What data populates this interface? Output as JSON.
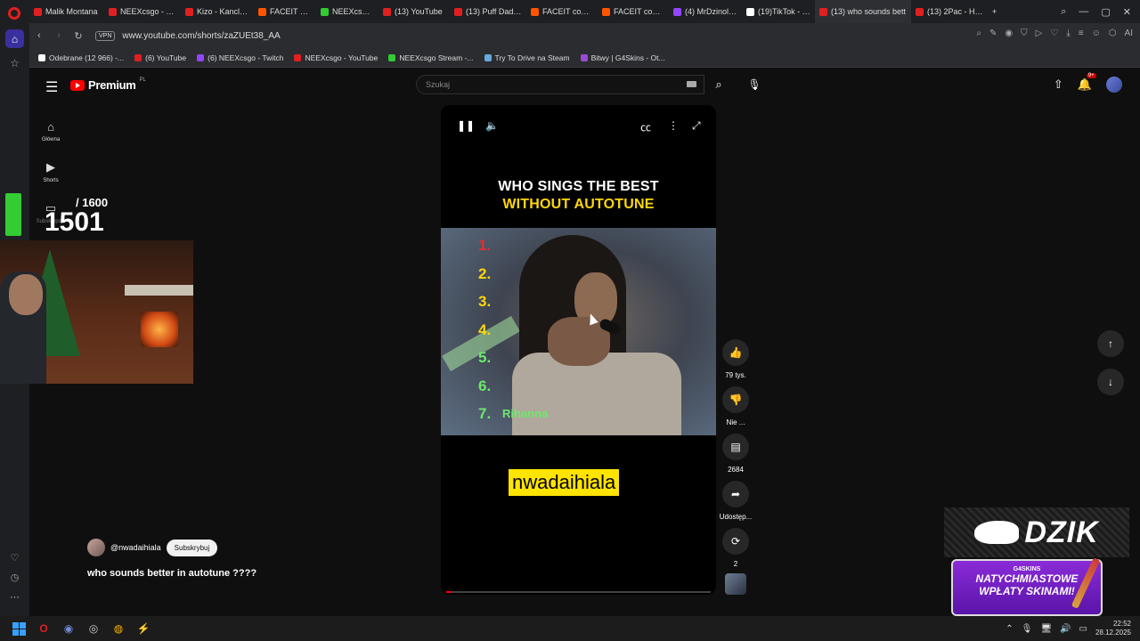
{
  "browser": {
    "tabs": [
      {
        "label": "Malik Montana",
        "color": "#e02020"
      },
      {
        "label": "NEEXcsgo - YouT",
        "color": "#e02020"
      },
      {
        "label": "Kizo - Kanclerz al",
        "color": "#e02020"
      },
      {
        "label": "FACEIT competiti",
        "color": "#ff5500"
      },
      {
        "label": "NEEXcsgo Stream",
        "color": "#33cc33"
      },
      {
        "label": "(13) YouTube",
        "color": "#e02020"
      },
      {
        "label": "(13) Puff Daddy [",
        "color": "#e02020"
      },
      {
        "label": "FACEIT competiti",
        "color": "#ff5500"
      },
      {
        "label": "FACEIT competiti",
        "color": "#ff5500"
      },
      {
        "label": "(4) MrDzinold - T",
        "color": "#9146ff"
      },
      {
        "label": "(19)TikTok - Mak",
        "color": "#ffffff"
      },
      {
        "label": "(13) who sounds bett",
        "color": "#e02020",
        "active": true
      },
      {
        "label": "(13) 2Pac - Hit 'Em",
        "color": "#e02020"
      }
    ],
    "vpn_label": "VPN",
    "url": "www.youtube.com/shorts/zaZUEt38_AA",
    "ai_label": "AI",
    "bookmarks": [
      {
        "label": "Odebrane (12 966) -...",
        "color": "#ffffff"
      },
      {
        "label": "(6) YouTube",
        "color": "#e02020"
      },
      {
        "label": "(6) NEEXcsgo - Twitch",
        "color": "#9146ff"
      },
      {
        "label": "NEEXcsgo - YouTube",
        "color": "#e02020"
      },
      {
        "label": "NEEXcsgo Stream -...",
        "color": "#33cc33"
      },
      {
        "label": "Try To Drive na Steam",
        "color": "#66aadd"
      },
      {
        "label": "Bitwy | G4Skins - Ot...",
        "color": "#9a4ad8"
      }
    ]
  },
  "youtube": {
    "logo_label": "Premium",
    "region": "PL",
    "search_placeholder": "Szukaj",
    "notifications_badge": "9+",
    "sidebar": [
      {
        "label": "Główna",
        "icon": "home-icon"
      },
      {
        "label": "Shorts",
        "icon": "shorts-icon"
      },
      {
        "label": "Subskrypcje",
        "icon": "subscriptions-icon"
      }
    ],
    "short": {
      "title_line1": "WHO SINGS THE BEST",
      "title_line2": "WITHOUT AUTOTUNE",
      "ranks": [
        {
          "num": "1.",
          "color": "#e03030"
        },
        {
          "num": "2.",
          "color": "#ffd60a"
        },
        {
          "num": "3.",
          "color": "#ffd60a"
        },
        {
          "num": "4.",
          "color": "#ffd60a"
        },
        {
          "num": "5.",
          "color": "#6de86d"
        },
        {
          "num": "6.",
          "color": "#6de86d"
        },
        {
          "num": "7.",
          "color": "#6de86d"
        }
      ],
      "rank7_name": "Rihanna",
      "caption": "nwadaihiala",
      "progress": 0.02
    },
    "actions": {
      "likes": "79 tys.",
      "dislike_label": "Nie ...",
      "comments": "2684",
      "share_label": "Udostęp...",
      "remix": "2"
    },
    "channel": {
      "handle": "@nwadaihiala",
      "subscribe_label": "Subskrybuj",
      "video_title": "who sounds better in autotune ????"
    }
  },
  "overlay": {
    "goal_total": "/ 1600",
    "goal_count": "1501",
    "dzik_brand": "DZIK",
    "promo_brand": "G4SKINS",
    "promo_line1": "NATYCHMIASTOWE",
    "promo_line2": "WPŁATY SKINAMI!"
  },
  "taskbar": {
    "time": "22:52",
    "date": "28.12.2025"
  }
}
